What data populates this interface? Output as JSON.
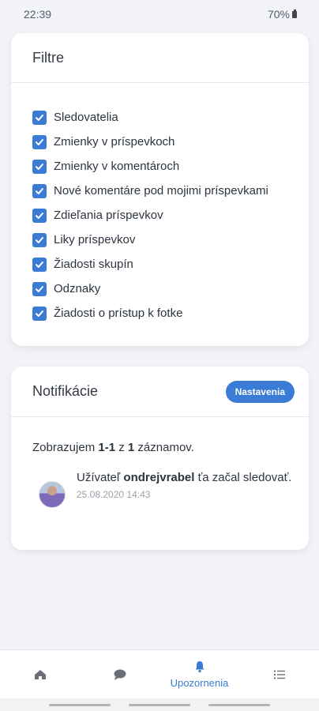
{
  "status_bar": {
    "time": "22:39",
    "battery": "70%"
  },
  "filters": {
    "title": "Filtre",
    "items": [
      {
        "label": "Sledovatelia",
        "checked": true
      },
      {
        "label": "Zmienky v príspevkoch",
        "checked": true
      },
      {
        "label": "Zmienky v komentároch",
        "checked": true
      },
      {
        "label": "Nové komentáre pod mojimi príspevkami",
        "checked": true
      },
      {
        "label": "Zdieľania príspevkov",
        "checked": true
      },
      {
        "label": "Liky príspevkov",
        "checked": true
      },
      {
        "label": "Žiadosti skupín",
        "checked": true
      },
      {
        "label": "Odznaky",
        "checked": true
      },
      {
        "label": "Žiadosti o prístup k fotke",
        "checked": true
      }
    ]
  },
  "notifications": {
    "title": "Notifikácie",
    "settings_label": "Nastavenia",
    "summary_prefix": "Zobrazujem ",
    "summary_range": "1-1",
    "summary_mid": " z ",
    "summary_total": "1",
    "summary_suffix": " záznamov.",
    "items": [
      {
        "text_prefix": "Užívateľ ",
        "user": "ondrejvrabel",
        "text_suffix": " ťa začal sledovať.",
        "time": "25.08.2020 14:43"
      }
    ]
  },
  "bottom_nav": {
    "items": [
      {
        "icon": "home-icon",
        "label": ""
      },
      {
        "icon": "chat-icon",
        "label": ""
      },
      {
        "icon": "bell-icon",
        "label": "Upozornenia",
        "active": true
      },
      {
        "icon": "list-icon",
        "label": ""
      }
    ]
  },
  "colors": {
    "accent": "#3a7bd5",
    "background": "#f2f4f9"
  }
}
